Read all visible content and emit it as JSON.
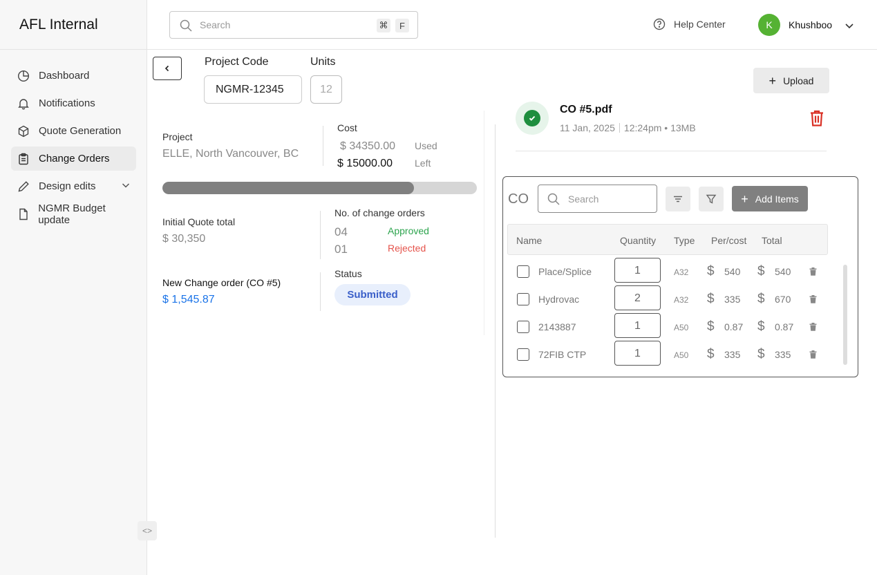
{
  "app": {
    "title": "AFL Internal"
  },
  "sidebar": {
    "items": [
      {
        "label": "Dashboard",
        "icon": "pie-chart-icon"
      },
      {
        "label": "Notifications",
        "icon": "bell-icon"
      },
      {
        "label": "Quote Generation",
        "icon": "cube-icon"
      },
      {
        "label": "Change Orders",
        "icon": "clipboard-icon",
        "active": true
      },
      {
        "label": "Design edits",
        "icon": "pencil-icon"
      },
      {
        "label": "NGMR Budget update",
        "icon": "document-icon"
      }
    ]
  },
  "header": {
    "search_placeholder": "Search",
    "shortcut_keys": [
      "⌘",
      "F"
    ],
    "help_label": "Help Center",
    "user": {
      "initial": "K",
      "name": "Khushboo"
    }
  },
  "project": {
    "code_label": "Project Code",
    "code_value": "NGMR-12345",
    "units_label": "Units",
    "units_value": "12",
    "project_label": "Project",
    "project_value": "ELLE, North Vancouver, BC",
    "cost_label": "Cost",
    "cost_used": "$ 34350.00",
    "cost_used_label": "Used",
    "cost_left": "$ 15000.00",
    "cost_left_label": "Left",
    "progress_fraction": 0.8,
    "initial_quote_label": "Initial Quote total",
    "initial_quote_value": "$ 30,350",
    "change_orders_label": "No. of change orders",
    "approved_count": "04",
    "approved_label": "Approved",
    "rejected_count": "01",
    "rejected_label": "Rejected",
    "new_co_label": "New Change order (CO #5)",
    "new_co_value": "$ 1,545.87",
    "status_label": "Status",
    "status_value": "Submitted"
  },
  "file": {
    "upload_label": "Upload",
    "name": "CO #5.pdf",
    "date": "11 Jan, 2025",
    "time_size": "12:24pm • 13MB"
  },
  "co_table": {
    "label": "CO",
    "search_placeholder": "Search",
    "add_label": "Add Items",
    "headers": [
      "Name",
      "Quantity",
      "Type",
      "Per/cost",
      "Total"
    ],
    "rows": [
      {
        "name": "Place/Splice",
        "qty": "1",
        "type": "A32",
        "per": "540",
        "total": "540"
      },
      {
        "name": "Hydrovac",
        "qty": "2",
        "type": "A32",
        "per": "335",
        "total": "670"
      },
      {
        "name": "2143887",
        "qty": "1",
        "type": "A50",
        "per": "0.87",
        "total": "0.87"
      },
      {
        "name": "72FIB CTP",
        "qty": "1",
        "type": "A50",
        "per": "335",
        "total": "335"
      }
    ],
    "currency_symbol": "$"
  },
  "colors": {
    "accent_green": "#55b233",
    "approved": "#2da44e",
    "rejected": "#e5534b",
    "link_blue": "#1a73e8",
    "danger": "#d93025"
  }
}
